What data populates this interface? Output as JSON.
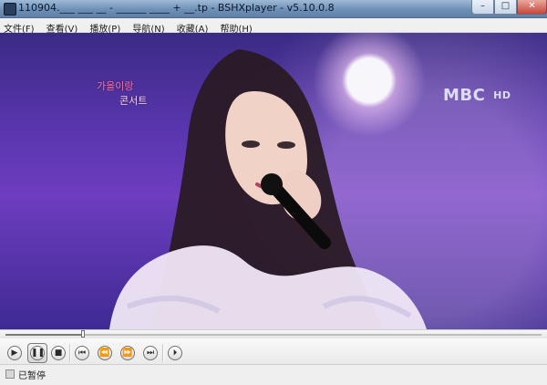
{
  "window": {
    "title": "110904.___ ___ __ - ______ ____ + __.tp - BSHXplayer - v5.10.0.8",
    "buttons": {
      "minimize_glyph": "–",
      "maximize_glyph": "□",
      "close_glyph": "✕"
    }
  },
  "menu": [
    {
      "label": "文件(F)"
    },
    {
      "label": "查看(V)"
    },
    {
      "label": "播放(P)"
    },
    {
      "label": "导航(N)"
    },
    {
      "label": "收藏(A)"
    },
    {
      "label": "帮助(H)"
    }
  ],
  "video": {
    "broadcaster_logo": {
      "main": "MBC",
      "suffix": "HD"
    },
    "program_logo": {
      "line1": "가을이랑",
      "line2": "콘서트"
    }
  },
  "playback": {
    "progress_fraction": 0.145,
    "state_text": "已暂停"
  },
  "controls": {
    "play_glyph": "▶",
    "pause_glyph": "❚❚",
    "stop_glyph": "■",
    "prev_glyph": "⏮",
    "rew_glyph": "⏪",
    "ff_glyph": "⏩",
    "next_glyph": "⏭",
    "frame_step_glyph": "⏵"
  },
  "colors": {
    "title_bar_top": "#9fb9d6",
    "title_bar_bottom": "#5f7fa6",
    "video_purple": "#5b36b0",
    "close_red": "#c9473a"
  }
}
